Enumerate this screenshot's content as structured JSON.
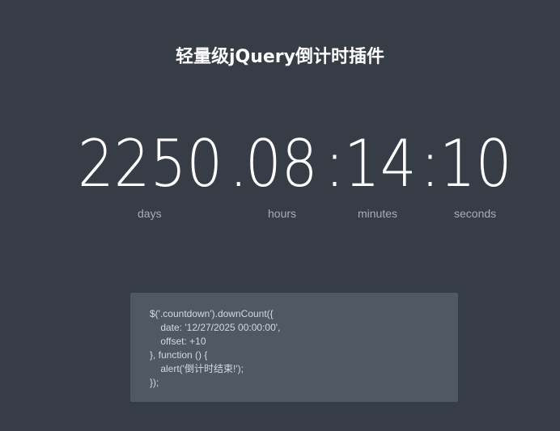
{
  "title": "轻量级jQuery倒计时插件",
  "countdown": {
    "days": "2250",
    "sep1": ".",
    "hours": "08",
    "sep2": ":",
    "minutes": "14",
    "sep3": ":",
    "seconds": "10"
  },
  "labels": {
    "days": "days",
    "hours": "hours",
    "minutes": "minutes",
    "seconds": "seconds"
  },
  "code": {
    "lines": [
      "$('.countdown').downCount({",
      "    date: '12/27/2025 00:00:00',",
      "    offset: +10",
      "}, function () {",
      "    alert('倒计时结束!');",
      "});"
    ]
  },
  "colors": {
    "background": "#373d47",
    "code_background": "#505863",
    "label": "#a8adb5"
  }
}
